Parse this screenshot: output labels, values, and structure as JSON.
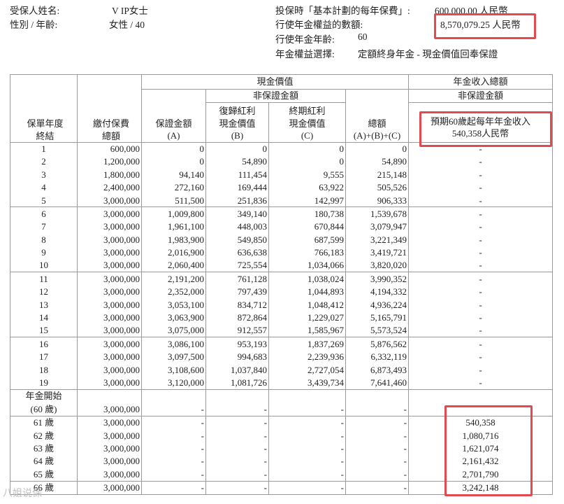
{
  "header": {
    "insured_label": "受保人姓名:",
    "insured_value": "V IP女士",
    "gender_age_label": "性別 / 年齡:",
    "gender_age_value": "女性 / 40",
    "premium_label": "投保時「基本計劃的每年保費」:",
    "premium_value": "600,000.00 人民幣",
    "annuity_benefit_label": "行使年金權益的數額:",
    "annuity_benefit_value": "8,570,079.25 人民幣",
    "annuity_age_label": "行使年金年齡:",
    "annuity_age_value": "60",
    "annuity_option_label": "年金權益選擇:",
    "annuity_option_value": "定額終身年金 - 現金價值回奉保證"
  },
  "table": {
    "group_cash_value": "現金價值",
    "group_annuity_income": "年金收入總額",
    "subgroup_non_guaranteed": "非保證金額",
    "subgroup_non_guaranteed_2": "非保證金額",
    "col_year": "保單年度\n終結",
    "col_premium": "繳付保費\n總額",
    "col_guaranteed": "保證金額\n(A)",
    "col_reversionary": "復歸紅利\n現金價值\n(B)",
    "col_terminal": "終期紅利\n現金價值\n(C)",
    "col_total": "總額\n(A)+(B)+(C)",
    "col_annuity": "預期60歲起每年年金收入\n540,358人民幣",
    "rows": [
      {
        "year": "1",
        "premium": "600,000",
        "a": "0",
        "b": "0",
        "c": "0",
        "total": "0",
        "annuity": "-"
      },
      {
        "year": "2",
        "premium": "1,200,000",
        "a": "0",
        "b": "54,890",
        "c": "0",
        "total": "54,890",
        "annuity": "-"
      },
      {
        "year": "3",
        "premium": "1,800,000",
        "a": "94,140",
        "b": "111,454",
        "c": "9,555",
        "total": "215,148",
        "annuity": "-"
      },
      {
        "year": "4",
        "premium": "2,400,000",
        "a": "272,160",
        "b": "169,444",
        "c": "63,922",
        "total": "505,526",
        "annuity": "-"
      },
      {
        "year": "5",
        "premium": "3,000,000",
        "a": "511,500",
        "b": "251,836",
        "c": "142,997",
        "total": "906,333",
        "annuity": "-"
      },
      {
        "year": "6",
        "premium": "3,000,000",
        "a": "1,009,800",
        "b": "349,140",
        "c": "180,738",
        "total": "1,539,678",
        "annuity": "-"
      },
      {
        "year": "7",
        "premium": "3,000,000",
        "a": "1,961,100",
        "b": "448,003",
        "c": "670,844",
        "total": "3,079,947",
        "annuity": "-"
      },
      {
        "year": "8",
        "premium": "3,000,000",
        "a": "1,983,900",
        "b": "549,850",
        "c": "687,599",
        "total": "3,221,349",
        "annuity": "-"
      },
      {
        "year": "9",
        "premium": "3,000,000",
        "a": "2,016,900",
        "b": "636,638",
        "c": "766,183",
        "total": "3,419,721",
        "annuity": "-"
      },
      {
        "year": "10",
        "premium": "3,000,000",
        "a": "2,060,400",
        "b": "725,554",
        "c": "1,034,066",
        "total": "3,820,020",
        "annuity": "-"
      },
      {
        "year": "11",
        "premium": "3,000,000",
        "a": "2,191,200",
        "b": "761,128",
        "c": "1,038,024",
        "total": "3,990,352",
        "annuity": "-"
      },
      {
        "year": "12",
        "premium": "3,000,000",
        "a": "2,352,000",
        "b": "797,439",
        "c": "1,044,893",
        "total": "4,194,332",
        "annuity": "-"
      },
      {
        "year": "13",
        "premium": "3,000,000",
        "a": "3,053,100",
        "b": "834,712",
        "c": "1,048,412",
        "total": "4,936,224",
        "annuity": "-"
      },
      {
        "year": "14",
        "premium": "3,000,000",
        "a": "3,063,900",
        "b": "872,864",
        "c": "1,229,027",
        "total": "5,165,791",
        "annuity": "-"
      },
      {
        "year": "15",
        "premium": "3,000,000",
        "a": "3,075,000",
        "b": "912,557",
        "c": "1,585,967",
        "total": "5,573,524",
        "annuity": "-"
      },
      {
        "year": "16",
        "premium": "3,000,000",
        "a": "3,086,100",
        "b": "953,193",
        "c": "1,837,269",
        "total": "5,876,562",
        "annuity": "-"
      },
      {
        "year": "17",
        "premium": "3,000,000",
        "a": "3,097,500",
        "b": "994,683",
        "c": "2,239,936",
        "total": "6,332,119",
        "annuity": "-"
      },
      {
        "year": "18",
        "premium": "3,000,000",
        "a": "3,108,600",
        "b": "1,037,840",
        "c": "2,727,054",
        "total": "6,873,493",
        "annuity": "-"
      },
      {
        "year": "19",
        "premium": "3,000,000",
        "a": "3,120,000",
        "b": "1,081,726",
        "c": "3,439,734",
        "total": "7,641,460",
        "annuity": "-"
      }
    ],
    "annuity_start_label": "年金開始",
    "annuity_start_row": {
      "year": "(60 歲)",
      "premium": "3,000,000",
      "a": "-",
      "b": "-",
      "c": "-",
      "total": "-",
      "annuity": ""
    },
    "annuity_rows": [
      {
        "year": "61 歲",
        "premium": "3,000,000",
        "a": "-",
        "b": "-",
        "c": "-",
        "total": "-",
        "annuity": "540,358"
      },
      {
        "year": "62 歲",
        "premium": "3,000,000",
        "a": "-",
        "b": "-",
        "c": "-",
        "total": "-",
        "annuity": "1,080,716"
      },
      {
        "year": "63 歲",
        "premium": "3,000,000",
        "a": "-",
        "b": "-",
        "c": "-",
        "total": "-",
        "annuity": "1,621,074"
      },
      {
        "year": "64 歲",
        "premium": "3,000,000",
        "a": "-",
        "b": "-",
        "c": "-",
        "total": "-",
        "annuity": "2,161,432"
      },
      {
        "year": "65 歲",
        "premium": "3,000,000",
        "a": "-",
        "b": "-",
        "c": "-",
        "total": "-",
        "annuity": "2,701,790"
      },
      {
        "year": "66 歲",
        "premium": "3,000,000",
        "a": "-",
        "b": "-",
        "c": "-",
        "total": "-",
        "annuity": "3,242,148"
      }
    ]
  },
  "highlight_color": "#e24a4f",
  "watermark": "八姐说保"
}
